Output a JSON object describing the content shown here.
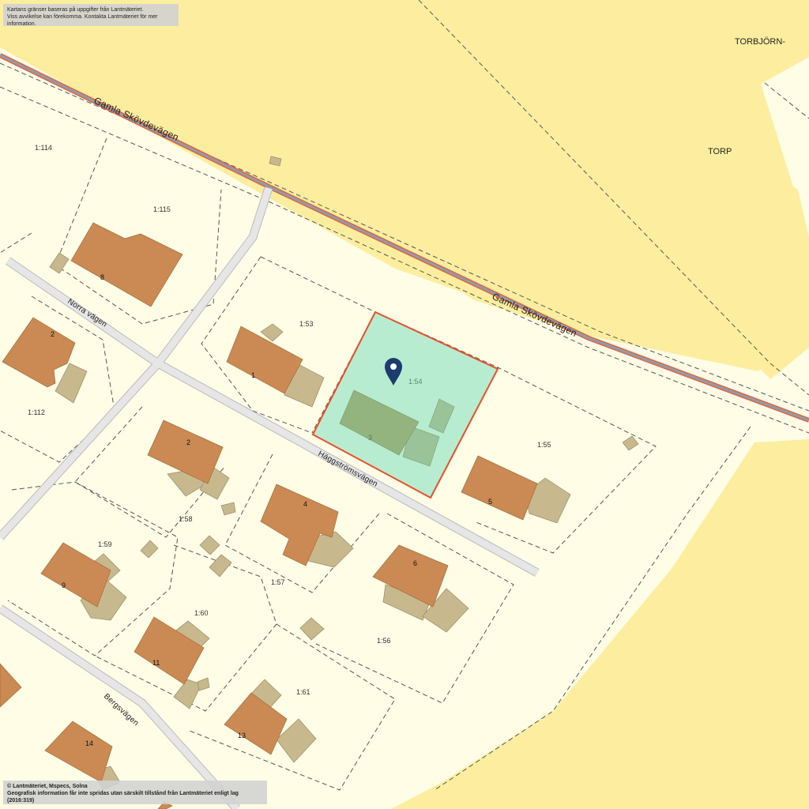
{
  "notices": {
    "top_line1": "Kartans gränser baseras på uppgifter från Lantmäteriet.",
    "top_line2": "Viss avvikelse kan förekomma. Kontakta Lantmäteriet för mer information.",
    "bottom_line1": "© Lantmäteriet, Mspecs, Solna",
    "bottom_line2": "Geografisk information får inte spridas utan särskilt tillstånd från Lantmäteriet enligt lag (2016:319)"
  },
  "areas": {
    "north": "TORBJÖRN-",
    "torp": "TORP"
  },
  "roads": {
    "main_a": "Gamla Skövdevägen",
    "main_b": "Gamla Skövdevägen",
    "norra": "Norra vägen",
    "haggstrom": "Häggströmsvägen",
    "berg": "Bergsvägen"
  },
  "parcels": {
    "p114": "1:114",
    "p115": "1:115",
    "p53": "1:53",
    "p54": "1:54",
    "p55": "1:55",
    "p112": "1:112",
    "p58": "1:58",
    "p59": "1:59",
    "p57": "1:57",
    "p56": "1:56",
    "p60": "1:60",
    "p61": "1:61"
  },
  "houses": {
    "h8": "8",
    "h2a": "2",
    "h1": "1",
    "h3": "3",
    "h2b": "2",
    "h4": "4",
    "h5": "5",
    "h6": "6",
    "h9": "9",
    "h11": "11",
    "h13": "13",
    "h14": "14"
  },
  "colors": {
    "background": "#fffde6",
    "field": "#fdee9f",
    "building": "#cb8a54",
    "outbuilding": "#c7b88e",
    "selected_parcel": "#b8ecd0",
    "selected_border": "#e8502a",
    "main_road": "#8aa0b0",
    "main_road_edge": "#e8603a",
    "local_road": "#e4e4e4",
    "marker": "#1b3d6e"
  },
  "icons": {
    "marker": "map-pin-icon"
  }
}
